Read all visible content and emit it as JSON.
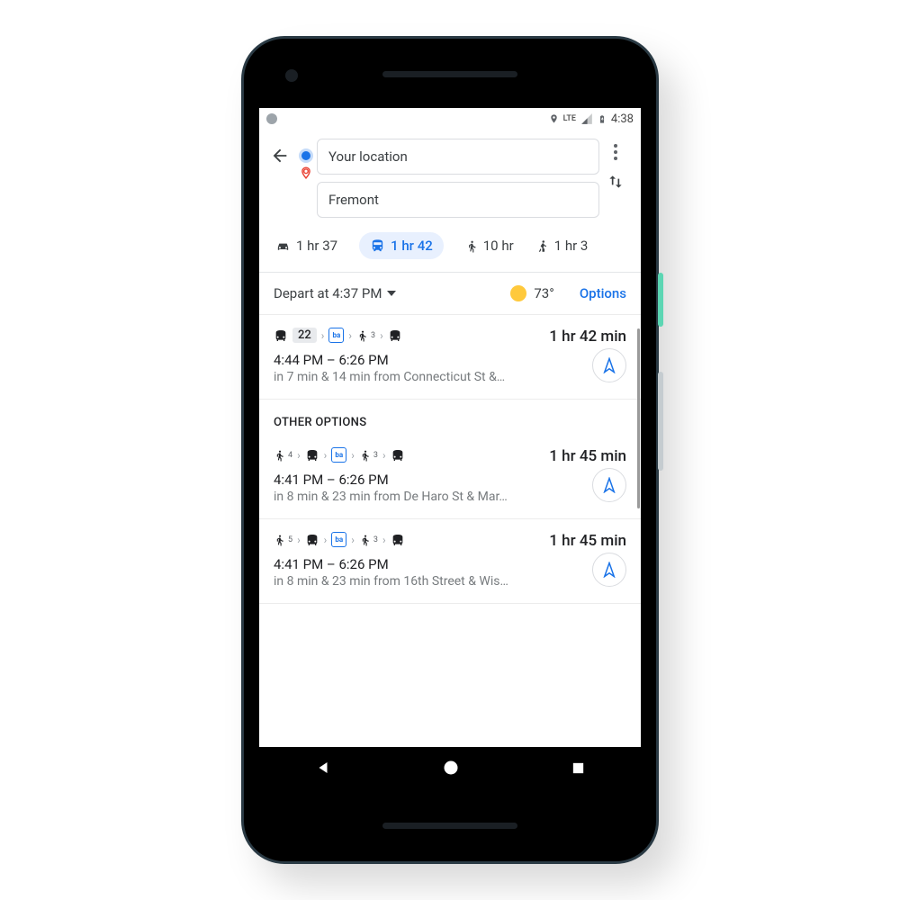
{
  "status_bar": {
    "network": "LTE",
    "time": "4:38"
  },
  "search": {
    "from": "Your location",
    "to": "Fremont"
  },
  "tabs": {
    "car": "1 hr 37",
    "transit": "1 hr 42",
    "walk": "10 hr",
    "rideshare": "1 hr 3"
  },
  "depart": {
    "label": "Depart at 4:37 PM",
    "temp": "73°",
    "options": "Options"
  },
  "routes": {
    "main": {
      "bus_label": "22",
      "walk_sub": "3",
      "duration": "1 hr 42 min",
      "times": "4:44 PM – 6:26 PM",
      "detail": "in 7 min & 14 min from Connecticut St &…"
    },
    "section_header": "OTHER OPTIONS",
    "alt1": {
      "walk1_sub": "4",
      "walk2_sub": "3",
      "duration": "1 hr 45 min",
      "times": "4:41 PM – 6:26 PM",
      "detail": "in 8 min & 23 min from De Haro St & Mar…"
    },
    "alt2": {
      "walk1_sub": "5",
      "walk2_sub": "3",
      "duration": "1 hr 45 min",
      "times": "4:41 PM – 6:26 PM",
      "detail": "in 8 min & 23 min from 16th Street & Wis…"
    }
  }
}
